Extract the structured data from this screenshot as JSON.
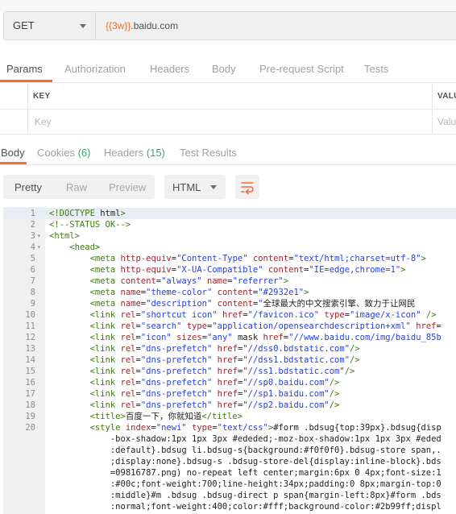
{
  "request": {
    "method": "GET",
    "url_var": "{{3w}}",
    "url_rest": ".baidu.com"
  },
  "request_tabs": [
    "Params",
    "Authorization",
    "Headers",
    "Body",
    "Pre-request Script",
    "Tests"
  ],
  "params_table": {
    "key_header": "KEY",
    "value_header": "VALU",
    "key_placeholder": "Key",
    "value_placeholder": "Valu"
  },
  "response_tabs": {
    "body": "Body",
    "cookies": "Cookies",
    "cookies_count": "(6)",
    "headers": "Headers",
    "headers_count": "(15)",
    "test_results": "Test Results"
  },
  "view_modes": [
    "Pretty",
    "Raw",
    "Preview"
  ],
  "format": "HTML",
  "icons": {
    "method_caret": "chevron-down-icon",
    "format_caret": "chevron-down-icon",
    "wrap": "wrap-lines-icon"
  },
  "colors": {
    "accent": "#f26b3a",
    "count": "#3aa86b"
  },
  "code_lines": [
    {
      "n": "1",
      "fold": "",
      "text": "<!DOCTYPE html>"
    },
    {
      "n": "2",
      "fold": "",
      "text": "<!--STATUS OK-->"
    },
    {
      "n": "3",
      "fold": "▾",
      "text": "<html>"
    },
    {
      "n": "4",
      "fold": "▾",
      "text": "    <head>"
    },
    {
      "n": "5",
      "fold": "",
      "text": "        <meta http-equiv=\"Content-Type\" content=\"text/html;charset=utf-8\">"
    },
    {
      "n": "6",
      "fold": "",
      "text": "        <meta http-equiv=\"X-UA-Compatible\" content=\"IE=edge,chrome=1\">"
    },
    {
      "n": "7",
      "fold": "",
      "text": "        <meta content=\"always\" name=\"referrer\">"
    },
    {
      "n": "8",
      "fold": "",
      "text": "        <meta name=\"theme-color\" content=\"#2932e1\">"
    },
    {
      "n": "9",
      "fold": "",
      "text": "        <meta name=\"description\" content=\"全球最大的中文搜索引擎、致力于让网民"
    },
    {
      "n": "10",
      "fold": "",
      "text": "        <link rel=\"shortcut icon\" href=\"/favicon.ico\" type=\"image/x-icon\" />"
    },
    {
      "n": "11",
      "fold": "",
      "text": "        <link rel=\"search\" type=\"application/opensearchdescription+xml\" href="
    },
    {
      "n": "12",
      "fold": "",
      "text": "        <link rel=\"icon\" sizes=\"any\" mask href=\"//www.baidu.com/img/baidu_85b"
    },
    {
      "n": "13",
      "fold": "",
      "text": "        <link rel=\"dns-prefetch\" href=\"//dss0.bdstatic.com\"/>"
    },
    {
      "n": "14",
      "fold": "",
      "text": "        <link rel=\"dns-prefetch\" href=\"//dss1.bdstatic.com\"/>"
    },
    {
      "n": "15",
      "fold": "",
      "text": "        <link rel=\"dns-prefetch\" href=\"//ss1.bdstatic.com\"/>"
    },
    {
      "n": "16",
      "fold": "",
      "text": "        <link rel=\"dns-prefetch\" href=\"//sp0.baidu.com\"/>"
    },
    {
      "n": "17",
      "fold": "",
      "text": "        <link rel=\"dns-prefetch\" href=\"//sp1.baidu.com\"/>"
    },
    {
      "n": "18",
      "fold": "",
      "text": "        <link rel=\"dns-prefetch\" href=\"//sp2.baidu.com\"/>"
    },
    {
      "n": "19",
      "fold": "",
      "text": "        <title>百度一下，你就知道</title>"
    },
    {
      "n": "20",
      "fold": "",
      "text": "        <style index=\"newi\" type=\"text/css\">#form .bdsug{top:39px}.bdsug{disp"
    },
    {
      "n": "",
      "fold": "",
      "text": "            -box-shadow:1px 1px 3px #ededed;-moz-box-shadow:1px 1px 3px #eded"
    },
    {
      "n": "",
      "fold": "",
      "text": "            :default}.bdsug li.bdsug-s{background:#f0f0f0}.bdsug-store span,."
    },
    {
      "n": "",
      "fold": "",
      "text": "            ;display:none}.bdsug-s .bdsug-store-del{display:inline-block}.bds"
    },
    {
      "n": "",
      "fold": "",
      "text": "            =09816787.png) no-repeat left center;margin:6px 0 4px;font-size:1"
    },
    {
      "n": "",
      "fold": "",
      "text": "            :#00c;font-weight:700;line-height:34px;padding:0 8px;margin-top:0"
    },
    {
      "n": "",
      "fold": "",
      "text": "            :middle}#m .bdsug .bdsug-direct p span{margin-left:8px}#form .bds"
    },
    {
      "n": "",
      "fold": "",
      "text": "            :normal;font-weight:400;color:#fff;background-color:#2b99ff;displ"
    }
  ]
}
